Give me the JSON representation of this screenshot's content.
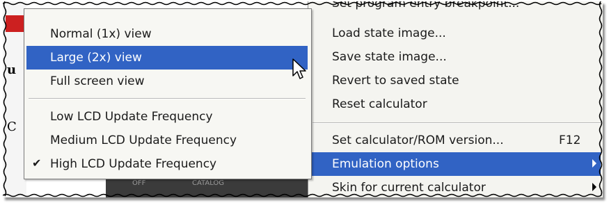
{
  "background": {
    "left_text": [
      "u",
      "C"
    ],
    "calc_labels": [
      "OFF",
      "CATALOG"
    ]
  },
  "main_menu": {
    "items": [
      {
        "label": "Set program entry breakpoint...",
        "shortcut": "",
        "submenu": false,
        "highlighted": false
      },
      {
        "label": "Load state image...",
        "shortcut": "",
        "submenu": false,
        "highlighted": false
      },
      {
        "label": "Save state image...",
        "shortcut": "",
        "submenu": false,
        "highlighted": false
      },
      {
        "label": "Revert to saved state",
        "shortcut": "",
        "submenu": false,
        "highlighted": false
      },
      {
        "label": "Reset calculator",
        "shortcut": "",
        "submenu": false,
        "highlighted": false
      },
      {
        "label": "Set calculator/ROM version...",
        "shortcut": "F12",
        "submenu": false,
        "highlighted": false
      },
      {
        "label": "Emulation options",
        "shortcut": "",
        "submenu": true,
        "highlighted": true
      },
      {
        "label": "Skin for current calculator",
        "shortcut": "",
        "submenu": true,
        "highlighted": false
      }
    ]
  },
  "submenu": {
    "items": [
      {
        "label": "Normal (1x) view",
        "checked": false,
        "highlighted": false
      },
      {
        "label": "Large (2x) view",
        "checked": false,
        "highlighted": true
      },
      {
        "label": "Full screen view",
        "checked": false,
        "highlighted": false
      },
      {
        "label": "Low LCD Update Frequency",
        "checked": false,
        "highlighted": false
      },
      {
        "label": "Medium LCD Update Frequency",
        "checked": false,
        "highlighted": false
      },
      {
        "label": "High LCD Update Frequency",
        "checked": true,
        "highlighted": false
      }
    ],
    "check_glyph": "✔"
  },
  "colors": {
    "highlight": "#3163c4",
    "menu_bg": "#f4f4f0"
  }
}
